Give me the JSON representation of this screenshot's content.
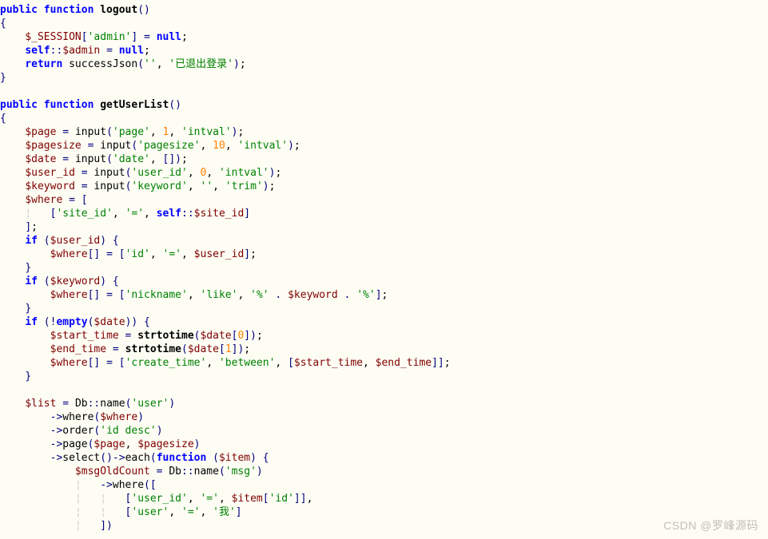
{
  "watermark": "CSDN @罗峰源码",
  "code": {
    "lines": [
      [
        [
          "kw",
          "public function "
        ],
        [
          "fn",
          "logout"
        ],
        [
          "brk",
          "()"
        ]
      ],
      [
        [
          "brk",
          "{"
        ]
      ],
      [
        [
          "pln",
          "    "
        ],
        [
          "var",
          "$_SESSION"
        ],
        [
          "brk",
          "["
        ],
        [
          "str",
          "'admin'"
        ],
        [
          "brk",
          "]"
        ],
        [
          "op",
          " = "
        ],
        [
          "kw",
          "null"
        ],
        [
          "pln",
          ";"
        ]
      ],
      [
        [
          "pln",
          "    "
        ],
        [
          "kw",
          "self"
        ],
        [
          "op",
          "::"
        ],
        [
          "var",
          "$admin"
        ],
        [
          "op",
          " = "
        ],
        [
          "kw",
          "null"
        ],
        [
          "pln",
          ";"
        ]
      ],
      [
        [
          "pln",
          "    "
        ],
        [
          "kw",
          "return"
        ],
        [
          "pln",
          " successJson"
        ],
        [
          "brk",
          "("
        ],
        [
          "str",
          "''"
        ],
        [
          "pln",
          ", "
        ],
        [
          "str",
          "'已退出登录'"
        ],
        [
          "brk",
          ")"
        ],
        [
          "pln",
          ";"
        ]
      ],
      [
        [
          "brk",
          "}"
        ]
      ],
      [
        [
          "pln",
          ""
        ]
      ],
      [
        [
          "kw",
          "public function "
        ],
        [
          "fn",
          "getUserList"
        ],
        [
          "brk",
          "()"
        ]
      ],
      [
        [
          "brk",
          "{"
        ]
      ],
      [
        [
          "pln",
          "    "
        ],
        [
          "var",
          "$page"
        ],
        [
          "op",
          " = "
        ],
        [
          "pln",
          "input"
        ],
        [
          "brk",
          "("
        ],
        [
          "str",
          "'page'"
        ],
        [
          "pln",
          ", "
        ],
        [
          "num",
          "1"
        ],
        [
          "pln",
          ", "
        ],
        [
          "str",
          "'intval'"
        ],
        [
          "brk",
          ")"
        ],
        [
          "pln",
          ";"
        ]
      ],
      [
        [
          "pln",
          "    "
        ],
        [
          "var",
          "$pagesize"
        ],
        [
          "op",
          " = "
        ],
        [
          "pln",
          "input"
        ],
        [
          "brk",
          "("
        ],
        [
          "str",
          "'pagesize'"
        ],
        [
          "pln",
          ", "
        ],
        [
          "num",
          "10"
        ],
        [
          "pln",
          ", "
        ],
        [
          "str",
          "'intval'"
        ],
        [
          "brk",
          ")"
        ],
        [
          "pln",
          ";"
        ]
      ],
      [
        [
          "pln",
          "    "
        ],
        [
          "var",
          "$date"
        ],
        [
          "op",
          " = "
        ],
        [
          "pln",
          "input"
        ],
        [
          "brk",
          "("
        ],
        [
          "str",
          "'date'"
        ],
        [
          "pln",
          ", "
        ],
        [
          "brk",
          "[])"
        ],
        [
          "pln",
          ";"
        ]
      ],
      [
        [
          "pln",
          "    "
        ],
        [
          "var",
          "$user_id"
        ],
        [
          "op",
          " = "
        ],
        [
          "pln",
          "input"
        ],
        [
          "brk",
          "("
        ],
        [
          "str",
          "'user_id'"
        ],
        [
          "pln",
          ", "
        ],
        [
          "num",
          "0"
        ],
        [
          "pln",
          ", "
        ],
        [
          "str",
          "'intval'"
        ],
        [
          "brk",
          ")"
        ],
        [
          "pln",
          ";"
        ]
      ],
      [
        [
          "pln",
          "    "
        ],
        [
          "var",
          "$keyword"
        ],
        [
          "op",
          " = "
        ],
        [
          "pln",
          "input"
        ],
        [
          "brk",
          "("
        ],
        [
          "str",
          "'keyword'"
        ],
        [
          "pln",
          ", "
        ],
        [
          "str",
          "''"
        ],
        [
          "pln",
          ", "
        ],
        [
          "str",
          "'trim'"
        ],
        [
          "brk",
          ")"
        ],
        [
          "pln",
          ";"
        ]
      ],
      [
        [
          "pln",
          "    "
        ],
        [
          "var",
          "$where"
        ],
        [
          "op",
          " = "
        ],
        [
          "brk",
          "["
        ]
      ],
      [
        [
          "pln",
          "    "
        ],
        [
          "guide",
          "¦   "
        ],
        [
          "brk",
          "["
        ],
        [
          "str",
          "'site_id'"
        ],
        [
          "pln",
          ", "
        ],
        [
          "str",
          "'='"
        ],
        [
          "pln",
          ", "
        ],
        [
          "kw",
          "self"
        ],
        [
          "op",
          "::"
        ],
        [
          "var",
          "$site_id"
        ],
        [
          "brk",
          "]"
        ]
      ],
      [
        [
          "pln",
          "    "
        ],
        [
          "brk",
          "]"
        ],
        [
          "pln",
          ";"
        ]
      ],
      [
        [
          "pln",
          "    "
        ],
        [
          "kw",
          "if"
        ],
        [
          "pln",
          " "
        ],
        [
          "brk",
          "("
        ],
        [
          "var",
          "$user_id"
        ],
        [
          "brk",
          ")"
        ],
        [
          "pln",
          " "
        ],
        [
          "brk",
          "{"
        ]
      ],
      [
        [
          "pln",
          "        "
        ],
        [
          "var",
          "$where"
        ],
        [
          "brk",
          "[]"
        ],
        [
          "op",
          " = "
        ],
        [
          "brk",
          "["
        ],
        [
          "str",
          "'id'"
        ],
        [
          "pln",
          ", "
        ],
        [
          "str",
          "'='"
        ],
        [
          "pln",
          ", "
        ],
        [
          "var",
          "$user_id"
        ],
        [
          "brk",
          "]"
        ],
        [
          "pln",
          ";"
        ]
      ],
      [
        [
          "pln",
          "    "
        ],
        [
          "brk",
          "}"
        ]
      ],
      [
        [
          "pln",
          "    "
        ],
        [
          "kw",
          "if"
        ],
        [
          "pln",
          " "
        ],
        [
          "brk",
          "("
        ],
        [
          "var",
          "$keyword"
        ],
        [
          "brk",
          ")"
        ],
        [
          "pln",
          " "
        ],
        [
          "brk",
          "{"
        ]
      ],
      [
        [
          "pln",
          "        "
        ],
        [
          "var",
          "$where"
        ],
        [
          "brk",
          "[]"
        ],
        [
          "op",
          " = "
        ],
        [
          "brk",
          "["
        ],
        [
          "str",
          "'nickname'"
        ],
        [
          "pln",
          ", "
        ],
        [
          "str",
          "'like'"
        ],
        [
          "pln",
          ", "
        ],
        [
          "str",
          "'%'"
        ],
        [
          "op",
          " . "
        ],
        [
          "var",
          "$keyword"
        ],
        [
          "op",
          " . "
        ],
        [
          "str",
          "'%'"
        ],
        [
          "brk",
          "]"
        ],
        [
          "pln",
          ";"
        ]
      ],
      [
        [
          "pln",
          "    "
        ],
        [
          "brk",
          "}"
        ]
      ],
      [
        [
          "pln",
          "    "
        ],
        [
          "kw",
          "if"
        ],
        [
          "pln",
          " "
        ],
        [
          "brk",
          "("
        ],
        [
          "op",
          "!"
        ],
        [
          "kw",
          "empty"
        ],
        [
          "brk",
          "("
        ],
        [
          "var",
          "$date"
        ],
        [
          "brk",
          "))"
        ],
        [
          "pln",
          " "
        ],
        [
          "brk",
          "{"
        ]
      ],
      [
        [
          "pln",
          "        "
        ],
        [
          "var",
          "$start_time"
        ],
        [
          "op",
          " = "
        ],
        [
          "fn",
          "strtotime"
        ],
        [
          "brk",
          "("
        ],
        [
          "var",
          "$date"
        ],
        [
          "brk",
          "["
        ],
        [
          "num",
          "0"
        ],
        [
          "brk",
          "])"
        ],
        [
          "pln",
          ";"
        ]
      ],
      [
        [
          "pln",
          "        "
        ],
        [
          "var",
          "$end_time"
        ],
        [
          "op",
          " = "
        ],
        [
          "fn",
          "strtotime"
        ],
        [
          "brk",
          "("
        ],
        [
          "var",
          "$date"
        ],
        [
          "brk",
          "["
        ],
        [
          "num",
          "1"
        ],
        [
          "brk",
          "])"
        ],
        [
          "pln",
          ";"
        ]
      ],
      [
        [
          "pln",
          "        "
        ],
        [
          "var",
          "$where"
        ],
        [
          "brk",
          "[]"
        ],
        [
          "op",
          " = "
        ],
        [
          "brk",
          "["
        ],
        [
          "str",
          "'create_time'"
        ],
        [
          "pln",
          ", "
        ],
        [
          "str",
          "'between'"
        ],
        [
          "pln",
          ", "
        ],
        [
          "brk",
          "["
        ],
        [
          "var",
          "$start_time"
        ],
        [
          "pln",
          ", "
        ],
        [
          "var",
          "$end_time"
        ],
        [
          "brk",
          "]]"
        ],
        [
          "pln",
          ";"
        ]
      ],
      [
        [
          "pln",
          "    "
        ],
        [
          "brk",
          "}"
        ]
      ],
      [
        [
          "pln",
          ""
        ]
      ],
      [
        [
          "pln",
          "    "
        ],
        [
          "var",
          "$list"
        ],
        [
          "op",
          " = "
        ],
        [
          "pln",
          "Db"
        ],
        [
          "op",
          "::"
        ],
        [
          "pln",
          "name"
        ],
        [
          "brk",
          "("
        ],
        [
          "str",
          "'user'"
        ],
        [
          "brk",
          ")"
        ]
      ],
      [
        [
          "pln",
          "        "
        ],
        [
          "op",
          "->"
        ],
        [
          "pln",
          "where"
        ],
        [
          "brk",
          "("
        ],
        [
          "var",
          "$where"
        ],
        [
          "brk",
          ")"
        ]
      ],
      [
        [
          "pln",
          "        "
        ],
        [
          "op",
          "->"
        ],
        [
          "pln",
          "order"
        ],
        [
          "brk",
          "("
        ],
        [
          "str",
          "'id desc'"
        ],
        [
          "brk",
          ")"
        ]
      ],
      [
        [
          "pln",
          "        "
        ],
        [
          "op",
          "->"
        ],
        [
          "pln",
          "page"
        ],
        [
          "brk",
          "("
        ],
        [
          "var",
          "$page"
        ],
        [
          "pln",
          ", "
        ],
        [
          "var",
          "$pagesize"
        ],
        [
          "brk",
          ")"
        ]
      ],
      [
        [
          "pln",
          "        "
        ],
        [
          "op",
          "->"
        ],
        [
          "pln",
          "select"
        ],
        [
          "brk",
          "()"
        ],
        [
          "op",
          "->"
        ],
        [
          "pln",
          "each"
        ],
        [
          "brk",
          "("
        ],
        [
          "kw",
          "function"
        ],
        [
          "pln",
          " "
        ],
        [
          "brk",
          "("
        ],
        [
          "var",
          "$item"
        ],
        [
          "brk",
          ")"
        ],
        [
          "pln",
          " "
        ],
        [
          "brk",
          "{"
        ]
      ],
      [
        [
          "pln",
          "            "
        ],
        [
          "var",
          "$msgOldCount"
        ],
        [
          "op",
          " = "
        ],
        [
          "pln",
          "Db"
        ],
        [
          "op",
          "::"
        ],
        [
          "pln",
          "name"
        ],
        [
          "brk",
          "("
        ],
        [
          "str",
          "'msg'"
        ],
        [
          "brk",
          ")"
        ]
      ],
      [
        [
          "pln",
          "            "
        ],
        [
          "guide",
          "¦   "
        ],
        [
          "op",
          "->"
        ],
        [
          "pln",
          "where"
        ],
        [
          "brk",
          "(["
        ]
      ],
      [
        [
          "pln",
          "            "
        ],
        [
          "guide",
          "¦   ¦   "
        ],
        [
          "brk",
          "["
        ],
        [
          "str",
          "'user_id'"
        ],
        [
          "pln",
          ", "
        ],
        [
          "str",
          "'='"
        ],
        [
          "pln",
          ", "
        ],
        [
          "var",
          "$item"
        ],
        [
          "brk",
          "["
        ],
        [
          "str",
          "'id'"
        ],
        [
          "brk",
          "]]"
        ],
        [
          "pln",
          ","
        ]
      ],
      [
        [
          "pln",
          "            "
        ],
        [
          "guide",
          "¦   ¦   "
        ],
        [
          "brk",
          "["
        ],
        [
          "str",
          "'user'"
        ],
        [
          "pln",
          ", "
        ],
        [
          "str",
          "'='"
        ],
        [
          "pln",
          ", "
        ],
        [
          "str",
          "'我'"
        ],
        [
          "brk",
          "]"
        ]
      ],
      [
        [
          "pln",
          "            "
        ],
        [
          "guide",
          "¦   "
        ],
        [
          "brk",
          "])"
        ]
      ]
    ]
  }
}
